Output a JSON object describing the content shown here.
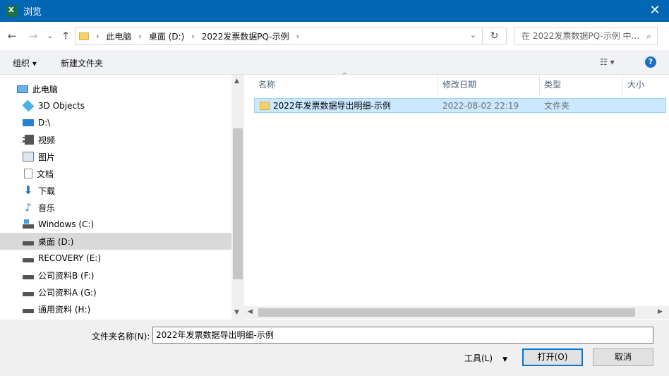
{
  "window": {
    "title": "浏览",
    "close_glyph": "✕"
  },
  "nav": {
    "back": "←",
    "forward": "→",
    "recent": "⌄",
    "up": "↑",
    "breadcrumb": [
      "此电脑",
      "桌面 (D:)",
      "2022发票数据PQ-示例"
    ],
    "sep": "›",
    "dropdown": "⌄",
    "refresh": "↻",
    "search_placeholder": "在 2022发票数据PQ-示例 中...",
    "search_icon": "⌕"
  },
  "toolbar": {
    "organize": "组织 ▾",
    "new_folder": "新建文件夹",
    "view_icon": "☷ ▾",
    "help": "?"
  },
  "sidebar": {
    "items": [
      {
        "label": "此电脑",
        "icon": "pc-icon"
      },
      {
        "label": "3D Objects",
        "icon": "3d-objects-icon"
      },
      {
        "label": "D:\\",
        "icon": "drive-icon"
      },
      {
        "label": "视频",
        "icon": "video-icon"
      },
      {
        "label": "图片",
        "icon": "pictures-icon"
      },
      {
        "label": "文档",
        "icon": "documents-icon"
      },
      {
        "label": "下载",
        "icon": "downloads-icon"
      },
      {
        "label": "音乐",
        "icon": "music-icon"
      },
      {
        "label": "Windows (C:)",
        "icon": "windows-drive-icon"
      },
      {
        "label": "桌面 (D:)",
        "icon": "hdd-icon",
        "selected": true
      },
      {
        "label": "RECOVERY (E:)",
        "icon": "hdd-icon"
      },
      {
        "label": "公司资料B (F:)",
        "icon": "hdd-icon"
      },
      {
        "label": "公司资料A (G:)",
        "icon": "hdd-icon"
      },
      {
        "label": "通用资料 (H:)",
        "icon": "hdd-icon"
      }
    ]
  },
  "columns": {
    "name": "名称",
    "modified": "修改日期",
    "type": "类型",
    "size": "大小",
    "sort_glyph": "^"
  },
  "files": [
    {
      "name": "2022年发票数据导出明细-示例",
      "modified": "2022-08-02 22:19",
      "type": "文件夹"
    }
  ],
  "scroll": {
    "up": "▲",
    "down": "▼",
    "left": "◀",
    "right": "▶"
  },
  "footer": {
    "folder_label": "文件夹名称(N):",
    "folder_value": "2022年发票数据导出明细-示例",
    "tools": "工具(L)",
    "tools_dd": "▼",
    "open": "打开(O)",
    "cancel": "取消"
  }
}
